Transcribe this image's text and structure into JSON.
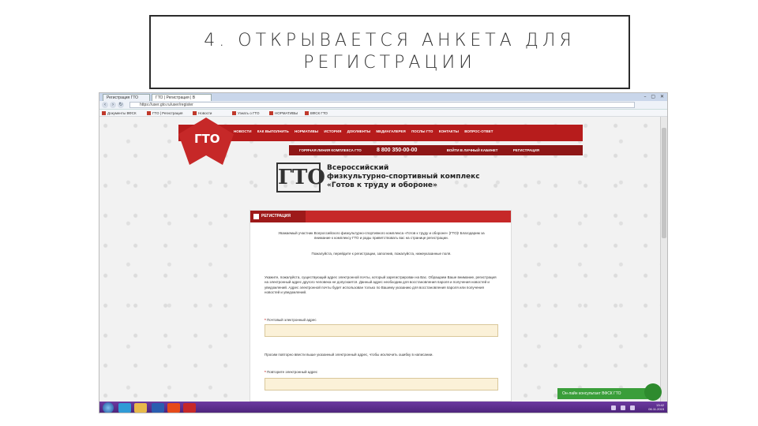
{
  "slide": {
    "title_line1": "4. ОТКРЫВАЕТСЯ АНКЕТА ДЛЯ",
    "title_line2": "РЕГИСТРАЦИИ"
  },
  "browser": {
    "tabs": [
      "Регистрация ГТО",
      "ГТО | Регистрация | В"
    ],
    "url": "https://user.gto.ru/user/register",
    "bookmarks": [
      "Документы ВФСК",
      "ГТО | Регистрация",
      "Новости",
      "Узнать о ГТО",
      "НОРМАТИВЫ",
      "ВФСК ГТО"
    ]
  },
  "site": {
    "logo": "ГТО",
    "menu": [
      "НОВОСТИ",
      "КАК ВЫПОЛНИТЬ",
      "НОРМАТИВЫ",
      "ИСТОРИЯ",
      "ДОКУМЕНТЫ",
      "МЕДИАГАЛЕРЕЯ",
      "ПОСЛЫ ГТО",
      "КОНТАКТЫ",
      "ВОПРОС-ОТВЕТ"
    ],
    "hotline_label": "ГОРЯЧАЯ ЛИНИЯ КОМПЛЕКСА ГТО",
    "hotline_phone": "8 800 350-00-00",
    "login": "ВОЙТИ В ЛИЧНЫЙ КАБИНЕТ",
    "register": "РЕГИСТРАЦИЯ",
    "brand_mark": "ГТО",
    "brand_line1": "Всероссийский",
    "brand_line2": "физкультурно-спортивный комплекс",
    "brand_line3": "«Готов к труду и обороне»"
  },
  "form": {
    "header": "РЕГИСТРАЦИЯ",
    "intro": "Уважаемый участник Всероссийского физкультурно-спортивного комплекса «Готов к труду и обороне» (ГТО)! Благодарим за внимание к комплексу ГТО и рады приветствовать вас на странице регистрации.",
    "intro2": "Пожалуйста, перейдите к регистрации, заполнив, пожалуйста, нижеуказанные поля.",
    "email_note": "Укажите, пожалуйста, существующий адрес электронной почты, который зарегистрирован на Вас. Обращаем Ваше внимание, регистрация на электронный адрес другого человека не допускается. Данный адрес необходим для восстановления пароля и получения новостей и уведомлений. Адрес электронной почты будет использован только по Вашему указанию для восстановления пароля или получения новостей и уведомлений.",
    "email_label": "Почтовый электронный адрес",
    "repeat_note": "Просим повторно ввести выше указанный электронный адрес, чтобы исключить ошибку в написании.",
    "repeat_label": "Повторите электронный адрес"
  },
  "chat": {
    "label": "Он-лайн консультант ВФСК ГТО"
  },
  "taskbar": {
    "time": "13:42",
    "date": "06.11.2015"
  }
}
